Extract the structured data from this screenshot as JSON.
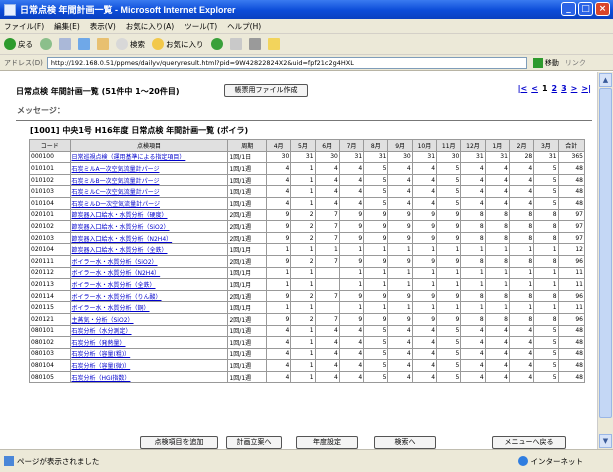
{
  "window": {
    "title": "日常点検 年間計画一覧 - Microsoft Internet Explorer",
    "buttons": [
      "_",
      "□",
      "×"
    ]
  },
  "menu": [
    "ファイル(F)",
    "編集(E)",
    "表示(V)",
    "お気に入り(A)",
    "ツール(T)",
    "ヘルプ(H)"
  ],
  "toolbar": {
    "back": "戻る",
    "search": "検索",
    "favorites": "お気に入り"
  },
  "address": {
    "label": "アドレス(D)",
    "url": "http://192.168.0.51/ppmes/dailyv/queryresult.html?pid=9W42822824X2&uid=fpf21c2g4HXL",
    "go": "移動",
    "links": "リンク"
  },
  "page": {
    "title": "日常点検 年間計画一覧 (51件中 1～20件目)",
    "export_button": "帳票用ファイル作成",
    "pager": [
      "|<",
      "<",
      "1",
      "2",
      "3",
      ">",
      ">|"
    ],
    "message_label": "メッセージ：",
    "section_title": "[1001] 中央1号 H16年度 日常点検 年間計画一覧 (ボイラ)"
  },
  "table": {
    "headers": [
      "コード",
      "点検項目",
      "周期",
      "4月",
      "5月",
      "6月",
      "7月",
      "8月",
      "9月",
      "10月",
      "11月",
      "12月",
      "1月",
      "2月",
      "3月",
      "合計"
    ],
    "rows": [
      [
        "000100",
        "日常巡視点検（運用基準による指定項目）",
        "1回/1日",
        "30",
        "31",
        "30",
        "31",
        "31",
        "30",
        "31",
        "30",
        "31",
        "31",
        "28",
        "31",
        "365"
      ],
      [
        "010101",
        "石炭ミルA一次空気流量計パージ",
        "1回/1週",
        "4",
        "1",
        "4",
        "4",
        "5",
        "4",
        "4",
        "5",
        "4",
        "4",
        "4",
        "5",
        "48"
      ],
      [
        "010102",
        "石炭ミルB一次空気流量計パージ",
        "1回/1週",
        "4",
        "1",
        "4",
        "4",
        "5",
        "4",
        "4",
        "5",
        "4",
        "4",
        "4",
        "5",
        "48"
      ],
      [
        "010103",
        "石炭ミルC一次空気流量計パージ",
        "1回/1週",
        "4",
        "1",
        "4",
        "4",
        "5",
        "4",
        "4",
        "5",
        "4",
        "4",
        "4",
        "5",
        "48"
      ],
      [
        "010104",
        "石炭ミルD一次空気流量計パージ",
        "1回/1週",
        "4",
        "1",
        "4",
        "4",
        "5",
        "4",
        "4",
        "5",
        "4",
        "4",
        "4",
        "5",
        "48"
      ],
      [
        "020101",
        "節炭器入口給水・水質分析（硬度）",
        "2回/1週",
        "9",
        "2",
        "7",
        "9",
        "9",
        "9",
        "9",
        "9",
        "8",
        "8",
        "8",
        "8",
        "97"
      ],
      [
        "020102",
        "節炭器入口給水・水質分析（SiO2）",
        "2回/1週",
        "9",
        "2",
        "7",
        "9",
        "9",
        "9",
        "9",
        "9",
        "8",
        "8",
        "8",
        "8",
        "97"
      ],
      [
        "020103",
        "節炭器入口給水・水質分析（N2H4）",
        "2回/1週",
        "9",
        "2",
        "7",
        "9",
        "9",
        "9",
        "9",
        "9",
        "8",
        "8",
        "8",
        "8",
        "97"
      ],
      [
        "020104",
        "節炭器入口給水・水質分析（全鉄）",
        "1回/1月",
        "1",
        "1",
        "1",
        "1",
        "1",
        "1",
        "1",
        "1",
        "1",
        "1",
        "1",
        "1",
        "12"
      ],
      [
        "020111",
        "ボイラー水・水質分析（SiO2）",
        "2回/1週",
        "9",
        "2",
        "7",
        "9",
        "9",
        "9",
        "9",
        "9",
        "8",
        "8",
        "8",
        "8",
        "96"
      ],
      [
        "020112",
        "ボイラー水・水質分析（N2H4）",
        "1回/1月",
        "1",
        "1",
        "",
        "1",
        "1",
        "1",
        "1",
        "1",
        "1",
        "1",
        "1",
        "1",
        "11"
      ],
      [
        "020113",
        "ボイラー水・水質分析（全鉄）",
        "1回/1月",
        "1",
        "1",
        "",
        "1",
        "1",
        "1",
        "1",
        "1",
        "1",
        "1",
        "1",
        "1",
        "11"
      ],
      [
        "020114",
        "ボイラー水・水質分析（りん酸）",
        "2回/1週",
        "9",
        "2",
        "7",
        "9",
        "9",
        "9",
        "9",
        "9",
        "8",
        "8",
        "8",
        "8",
        "96"
      ],
      [
        "020115",
        "ボイラー水・水質分析（銅）",
        "1回/1月",
        "1",
        "1",
        "",
        "1",
        "1",
        "1",
        "1",
        "1",
        "1",
        "1",
        "1",
        "1",
        "11"
      ],
      [
        "020121",
        "主蒸気・分析（SiO2）",
        "2回/1週",
        "9",
        "2",
        "7",
        "9",
        "9",
        "9",
        "9",
        "9",
        "8",
        "8",
        "8",
        "8",
        "96"
      ],
      [
        "080101",
        "石炭分析（水分測定）",
        "1回/1週",
        "4",
        "1",
        "4",
        "4",
        "5",
        "4",
        "4",
        "5",
        "4",
        "4",
        "4",
        "5",
        "48"
      ],
      [
        "080102",
        "石炭分析（発熱量）",
        "1回/1週",
        "4",
        "1",
        "4",
        "4",
        "5",
        "4",
        "4",
        "5",
        "4",
        "4",
        "4",
        "5",
        "48"
      ],
      [
        "080103",
        "石炭分析（容量(粗)）",
        "1回/1週",
        "4",
        "1",
        "4",
        "4",
        "5",
        "4",
        "4",
        "5",
        "4",
        "4",
        "4",
        "5",
        "48"
      ],
      [
        "080104",
        "石炭分析（容量(微)）",
        "1回/1週",
        "4",
        "1",
        "4",
        "4",
        "5",
        "4",
        "4",
        "5",
        "4",
        "4",
        "4",
        "5",
        "48"
      ],
      [
        "080105",
        "石炭分析（HGI指数）",
        "1回/1週",
        "4",
        "1",
        "4",
        "4",
        "5",
        "4",
        "4",
        "5",
        "4",
        "4",
        "4",
        "5",
        "48"
      ]
    ]
  },
  "footer_buttons": [
    "点検項目を追加",
    "計画立案へ",
    "年度設定",
    "検索へ",
    "メニューへ戻る"
  ],
  "status": {
    "text": "ページが表示されました",
    "zone": "インターネット"
  }
}
